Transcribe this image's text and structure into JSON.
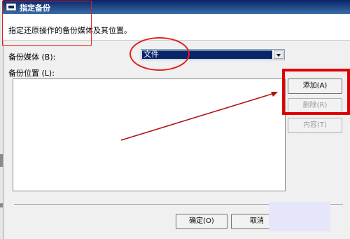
{
  "dialog": {
    "title": "指定备份",
    "description": "指定还原操作的备份媒体及其位置。"
  },
  "form": {
    "media_label": "备份媒体 (B):",
    "media_selected": "文件",
    "location_label": "备份位置 (L):"
  },
  "buttons": {
    "add": "添加(A)",
    "delete": "删除(R)",
    "contents": "内容(T)",
    "ok": "确定(O)",
    "cancel": "取消"
  },
  "colors": {
    "annotation_red": "#e02020",
    "selection_blue": "#0a246a"
  }
}
